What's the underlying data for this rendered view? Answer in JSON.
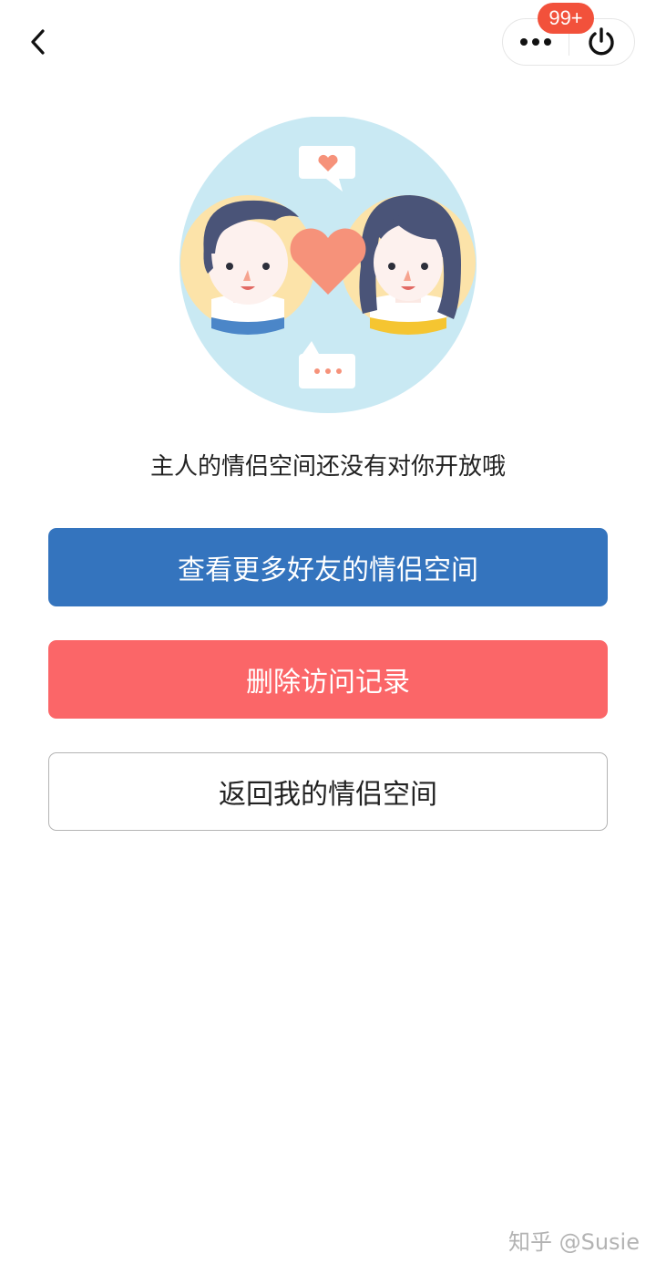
{
  "nav": {
    "back_icon": "chevron-left-icon",
    "more_icon": "more-dots-icon",
    "power_icon": "power-icon",
    "badge_count": "99+",
    "badge_color": "#f2513b"
  },
  "illustration": {
    "description_icon": "couple-illustration",
    "colors": {
      "circle": "#c9e9f3",
      "face_bg": "#fce3a9",
      "heart": "#f6927a",
      "hair": "#4a5478"
    }
  },
  "message": "主人的情侣空间还没有对你开放哦",
  "actions": {
    "more_friends": "查看更多好友的情侣空间",
    "delete_history": "删除访问记录",
    "return_mine": "返回我的情侣空间"
  },
  "colors": {
    "primary": "#3474be",
    "danger": "#fb6668"
  },
  "watermark": "知乎 @Susie"
}
